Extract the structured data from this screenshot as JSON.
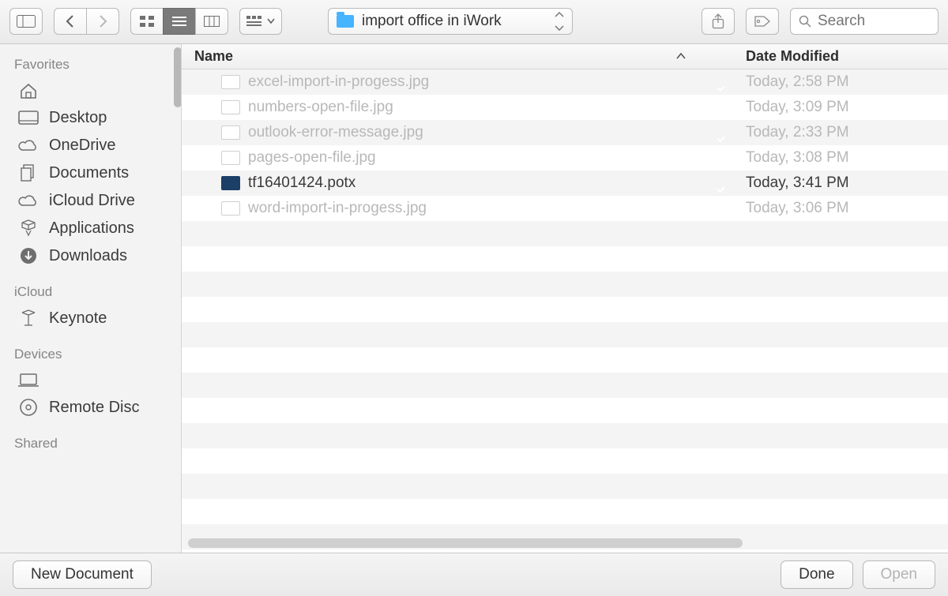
{
  "toolbar": {
    "current_folder": "import office in iWork",
    "search_placeholder": "Search"
  },
  "sidebar": {
    "sections": [
      {
        "heading": "Favorites",
        "items": [
          {
            "icon": "home-icon",
            "label": ""
          },
          {
            "icon": "desktop-icon",
            "label": "Desktop"
          },
          {
            "icon": "cloud-icon",
            "label": "OneDrive"
          },
          {
            "icon": "documents-icon",
            "label": "Documents"
          },
          {
            "icon": "cloud-icon",
            "label": "iCloud Drive"
          },
          {
            "icon": "applications-icon",
            "label": "Applications"
          },
          {
            "icon": "downloads-icon",
            "label": "Downloads"
          }
        ]
      },
      {
        "heading": "iCloud",
        "items": [
          {
            "icon": "keynote-icon",
            "label": "Keynote"
          }
        ]
      },
      {
        "heading": "Devices",
        "items": [
          {
            "icon": "laptop-icon",
            "label": ""
          },
          {
            "icon": "disc-icon",
            "label": "Remote Disc"
          }
        ]
      },
      {
        "heading": "Shared",
        "items": []
      }
    ]
  },
  "list": {
    "columns": {
      "name": "Name",
      "date": "Date Modified"
    },
    "sort": {
      "column": "name",
      "direction": "asc"
    },
    "rows": [
      {
        "name": "excel-import-in-progess.jpg",
        "date": "Today, 2:58 PM",
        "synced": true,
        "enabled": false,
        "kind": "jpg"
      },
      {
        "name": "numbers-open-file.jpg",
        "date": "Today, 3:09 PM",
        "synced": true,
        "enabled": false,
        "kind": "jpg"
      },
      {
        "name": "outlook-error-message.jpg",
        "date": "Today, 2:33 PM",
        "synced": true,
        "enabled": false,
        "kind": "jpg"
      },
      {
        "name": "pages-open-file.jpg",
        "date": "Today, 3:08 PM",
        "synced": true,
        "enabled": false,
        "kind": "jpg"
      },
      {
        "name": "tf16401424.potx",
        "date": "Today, 3:41 PM",
        "synced": true,
        "enabled": true,
        "kind": "potx"
      },
      {
        "name": "word-import-in-progess.jpg",
        "date": "Today, 3:06 PM",
        "synced": true,
        "enabled": false,
        "kind": "jpg"
      }
    ]
  },
  "footer": {
    "new_document": "New Document",
    "done": "Done",
    "open": "Open",
    "open_enabled": false
  }
}
